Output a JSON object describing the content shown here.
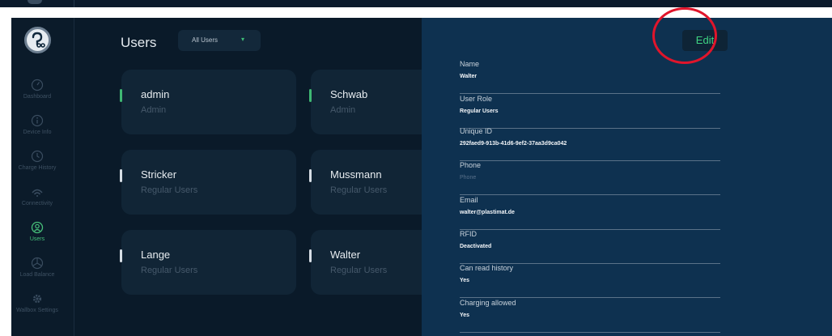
{
  "sidebar": {
    "items": [
      {
        "label": "Dashboard",
        "icon": "gauge-icon"
      },
      {
        "label": "Device Info",
        "icon": "info-icon"
      },
      {
        "label": "Charge History",
        "icon": "clock-icon"
      },
      {
        "label": "Connectivity",
        "icon": "wifi-icon"
      },
      {
        "label": "Users",
        "icon": "user-icon",
        "active": true
      },
      {
        "label": "Load Balance",
        "icon": "balance-icon"
      },
      {
        "label": "Wallbox Settings",
        "icon": "gear-icon"
      }
    ]
  },
  "users": {
    "title": "Users",
    "filter": {
      "value": "All Users",
      "caret": "▾"
    },
    "cards": [
      {
        "name": "admin",
        "role": "Admin"
      },
      {
        "name": "Schwab",
        "role": "Admin"
      },
      {
        "name": "Stricker",
        "role": "Regular Users"
      },
      {
        "name": "Mussmann",
        "role": "Regular Users"
      },
      {
        "name": "Lange",
        "role": "Regular Users"
      },
      {
        "name": "Walter",
        "role": "Regular Users"
      }
    ]
  },
  "detail": {
    "edit_label": "Edit",
    "fields": [
      {
        "label": "Name",
        "value": "Walter"
      },
      {
        "label": "User Role",
        "value": "Regular Users"
      },
      {
        "label": "Unique ID",
        "value": "292faed9-913b-41d6-9ef2-37aa3d9ca042"
      },
      {
        "label": "Phone",
        "value": "Phone"
      },
      {
        "label": "Email",
        "value": "walter@plastimat.de"
      },
      {
        "label": "RFID",
        "value": "Deactivated"
      },
      {
        "label": "Can read history",
        "value": "Yes"
      },
      {
        "label": "Charging allowed",
        "value": "Yes"
      }
    ]
  },
  "colors": {
    "accent": "#3fd483",
    "highlight_circle": "#e0152b",
    "detail_background": "#0e3150",
    "app_background": "#0a1a29"
  }
}
